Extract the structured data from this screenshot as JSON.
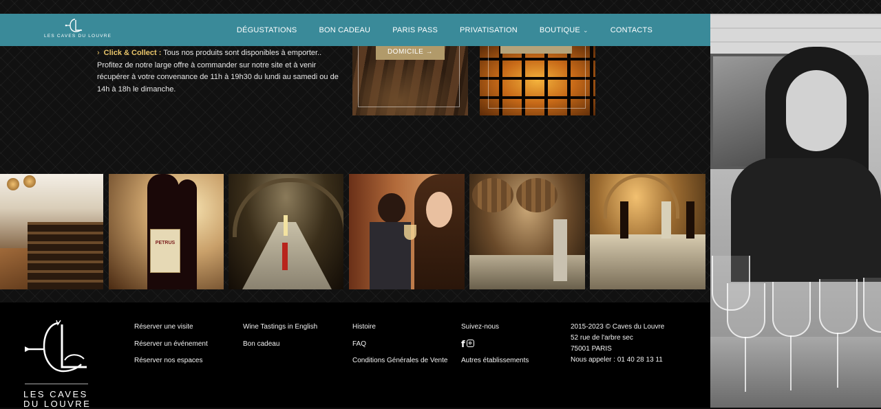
{
  "brand": {
    "logo_text": "LES CAVES DU LOUVRE",
    "footer_logo_line1": "LES CAVES",
    "footer_logo_line2": "DU LOUVRE"
  },
  "nav": {
    "items": [
      {
        "label": "DÉGUSTATIONS"
      },
      {
        "label": "BON CADEAU"
      },
      {
        "label": "PARIS PASS"
      },
      {
        "label": "PRIVATISATION"
      },
      {
        "label": "BOUTIQUE",
        "has_dropdown": true
      },
      {
        "label": "CONTACTS"
      }
    ],
    "bg_color": "#3a8a99"
  },
  "click_collect": {
    "label": "Click & Collect :",
    "text": "Tous nos produits sont disponibles à emporter.. Profitez de notre large offre à commander sur notre site et à venir récupérer à votre convenance de 11h à 19h30 du lundi au samedi ou de 14h à 18h le dimanche.",
    "accent_color": "#e9c56a"
  },
  "promos": [
    {
      "label": "DOMICILE →"
    },
    {
      "label": ""
    }
  ],
  "gallery": {
    "items": [
      {
        "name": "wine-shop-interior"
      },
      {
        "name": "petrus-bottle",
        "label_text": "PETRUS"
      },
      {
        "name": "vaulted-cellar-table"
      },
      {
        "name": "tasting-woman"
      },
      {
        "name": "barrel-room-table"
      },
      {
        "name": "cellar-arches-table"
      }
    ]
  },
  "footer": {
    "col1": [
      "Réserver une visite",
      "Réserver un événement",
      "Réserver nos espaces"
    ],
    "col2": [
      "Wine Tastings in English",
      "Bon cadeau"
    ],
    "col3": [
      "Histoire",
      "FAQ",
      "Conditions Générales de Vente"
    ],
    "col4": {
      "follow_label": "Suivez-nous",
      "social_icons": [
        "facebook-icon",
        "instagram-icon"
      ],
      "other": "Autres établissements"
    },
    "col5": [
      "2015-2023 © Caves du Louvre",
      "52 rue de l'arbre sec",
      "75001 PARIS",
      "Nous appeler : 01 40 28 13 11"
    ]
  }
}
